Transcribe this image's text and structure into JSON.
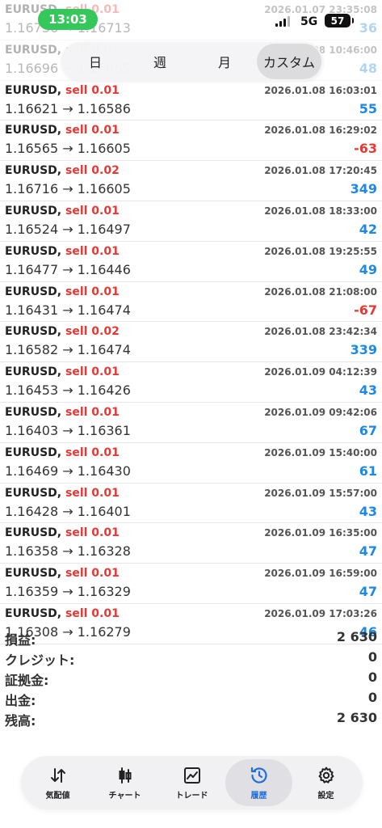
{
  "status_bar": {
    "time": "13:03",
    "network": "5G",
    "battery": "57"
  },
  "filter": {
    "tabs": [
      "日",
      "週",
      "月",
      "カスタム"
    ],
    "active": "カスタム"
  },
  "trades": [
    {
      "symbol": "EURUSD,",
      "side": "sell 0.01",
      "date": "2026.01.07 23:35:08",
      "prices": "1.16736 → 1.16713",
      "profit": "36",
      "positive": true
    },
    {
      "symbol": "EURUSD,",
      "side": "sell 0.01",
      "date": "2026.01.08 10:46:00",
      "prices": "1.16696 → 1.16665",
      "profit": "48",
      "positive": true
    },
    {
      "symbol": "EURUSD,",
      "side": "sell 0.01",
      "date": "2026.01.08 16:03:01",
      "prices": "1.16621 → 1.16586",
      "profit": "55",
      "positive": true
    },
    {
      "symbol": "EURUSD,",
      "side": "sell 0.01",
      "date": "2026.01.08 16:29:02",
      "prices": "1.16565 → 1.16605",
      "profit": "-63",
      "positive": false
    },
    {
      "symbol": "EURUSD,",
      "side": "sell 0.02",
      "date": "2026.01.08 17:20:45",
      "prices": "1.16716 → 1.16605",
      "profit": "349",
      "positive": true
    },
    {
      "symbol": "EURUSD,",
      "side": "sell 0.01",
      "date": "2026.01.08 18:33:00",
      "prices": "1.16524 → 1.16497",
      "profit": "42",
      "positive": true
    },
    {
      "symbol": "EURUSD,",
      "side": "sell 0.01",
      "date": "2026.01.08 19:25:55",
      "prices": "1.16477 → 1.16446",
      "profit": "49",
      "positive": true
    },
    {
      "symbol": "EURUSD,",
      "side": "sell 0.01",
      "date": "2026.01.08 21:08:00",
      "prices": "1.16431 → 1.16474",
      "profit": "-67",
      "positive": false
    },
    {
      "symbol": "EURUSD,",
      "side": "sell 0.02",
      "date": "2026.01.08 23:42:34",
      "prices": "1.16582 → 1.16474",
      "profit": "339",
      "positive": true
    },
    {
      "symbol": "EURUSD,",
      "side": "sell 0.01",
      "date": "2026.01.09 04:12:39",
      "prices": "1.16453 → 1.16426",
      "profit": "43",
      "positive": true
    },
    {
      "symbol": "EURUSD,",
      "side": "sell 0.01",
      "date": "2026.01.09 09:42:06",
      "prices": "1.16403 → 1.16361",
      "profit": "67",
      "positive": true
    },
    {
      "symbol": "EURUSD,",
      "side": "sell 0.01",
      "date": "2026.01.09 15:40:00",
      "prices": "1.16469 → 1.16430",
      "profit": "61",
      "positive": true
    },
    {
      "symbol": "EURUSD,",
      "side": "sell 0.01",
      "date": "2026.01.09 15:57:00",
      "prices": "1.16428 → 1.16401",
      "profit": "43",
      "positive": true
    },
    {
      "symbol": "EURUSD,",
      "side": "sell 0.01",
      "date": "2026.01.09 16:35:00",
      "prices": "1.16358 → 1.16328",
      "profit": "47",
      "positive": true
    },
    {
      "symbol": "EURUSD,",
      "side": "sell 0.01",
      "date": "2026.01.09 16:59:00",
      "prices": "1.16359 → 1.16329",
      "profit": "47",
      "positive": true
    },
    {
      "symbol": "EURUSD,",
      "side": "sell 0.01",
      "date": "2026.01.09 17:03:26",
      "prices": "1.16308 → 1.16279",
      "profit": "46",
      "positive": true
    }
  ],
  "summary": [
    {
      "label": "損益:",
      "value": "2 630"
    },
    {
      "label": "クレジット:",
      "value": "0"
    },
    {
      "label": "証拠金:",
      "value": "0"
    },
    {
      "label": "出金:",
      "value": "0"
    },
    {
      "label": "残高:",
      "value": "2 630"
    }
  ],
  "nav": [
    {
      "label": "気配値",
      "icon": "arrows-updown-icon"
    },
    {
      "label": "チャート",
      "icon": "candlestick-icon"
    },
    {
      "label": "トレード",
      "icon": "trade-chart-icon"
    },
    {
      "label": "履歴",
      "icon": "history-icon",
      "active": true
    },
    {
      "label": "設定",
      "icon": "gear-icon"
    }
  ],
  "colors": {
    "positive": "#1e88e5",
    "negative": "#e53935",
    "active_tab": "#1e6fd9",
    "time_pill": "#34c759"
  }
}
